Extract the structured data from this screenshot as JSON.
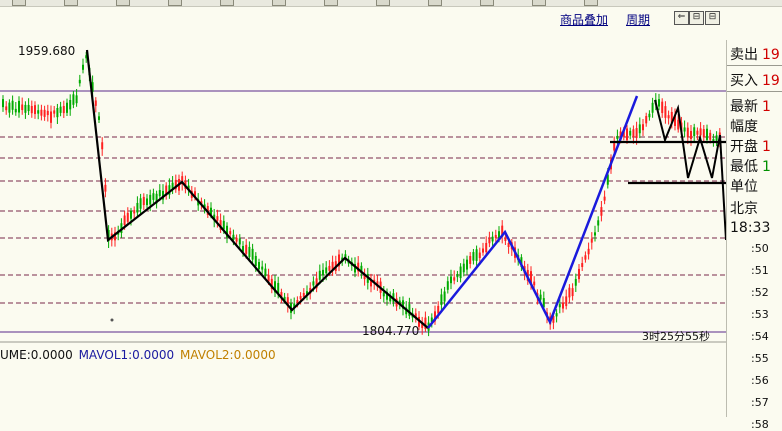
{
  "toolbar": {
    "buttons": [
      "btn1",
      "btn2",
      "btn3",
      "btn4",
      "btn5",
      "btn6",
      "btn7",
      "btn8",
      "btn9",
      "btn10",
      "btn11",
      "btn12"
    ]
  },
  "chart_header": {
    "overlay_link": "商品叠加",
    "period_link": "周期",
    "nav_buttons": [
      "⇐",
      "⊟",
      "⊟"
    ]
  },
  "chart": {
    "high_label": "1959.680",
    "low_label": "1804.770",
    "countdown": "3时25分55秒",
    "colors": {
      "up": "#ff2020",
      "down": "#00aa00",
      "trend_black": "#000000",
      "trend_blue": "#1a1adc",
      "ref_line": "#5a2a8a"
    }
  },
  "volume": {
    "labels": [
      "UME:0.0000",
      "MAVOL1:0.0000",
      "MAVOL2:0.0000"
    ],
    "colors": [
      "#111111",
      "#1a1aa0",
      "#c08000"
    ]
  },
  "side_panel": {
    "rows": [
      {
        "label": "卖出",
        "value": "19"
      },
      {
        "label": "买入",
        "value": "19"
      },
      {
        "label": "最新",
        "value": "1"
      },
      {
        "label": "幅度",
        "value": ""
      },
      {
        "label": "开盘",
        "value": "1"
      },
      {
        "label": "最低",
        "value": "1"
      },
      {
        "label": "单位",
        "value": ""
      },
      {
        "label": "北京",
        "value": ""
      },
      {
        "label": "18:33",
        "value": ""
      }
    ],
    "ticks": [
      ":50",
      ":51",
      ":52",
      ":53",
      ":54",
      ":55",
      ":56",
      ":57",
      ":58"
    ]
  }
}
